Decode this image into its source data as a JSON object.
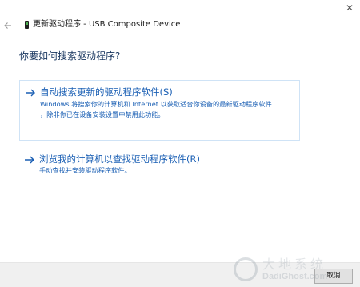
{
  "window": {
    "title": "更新驱动程序 - USB Composite Device",
    "back_icon": "back-arrow-icon",
    "device_icon": "usb-device-icon",
    "close_symbol": "✕"
  },
  "main": {
    "heading": "你要如何搜索驱动程序?",
    "options": [
      {
        "title": "自动搜索更新的驱动程序软件(S)",
        "description_lines": [
          "Windows 将搜索你的计算机和 Internet 以获取适合你设备的最新驱动程序软件",
          "，除非你已在设备安装设置中禁用此功能。"
        ],
        "icon": "arrow-right-icon"
      },
      {
        "title": "浏览我的计算机以查找驱动程序软件(R)",
        "description_lines": [
          "手动查找并安装驱动程序软件。"
        ],
        "icon": "arrow-right-icon"
      }
    ]
  },
  "footer": {
    "cancel_label": "取消"
  },
  "watermark": {
    "text_cn": "大地系统",
    "text_en": "DadiGhost.com"
  },
  "colors": {
    "link_blue": "#1a5fb4",
    "heading_navy": "#14325c",
    "option_border": "#cfe3f6",
    "footer_bg": "#f0f0f0"
  }
}
